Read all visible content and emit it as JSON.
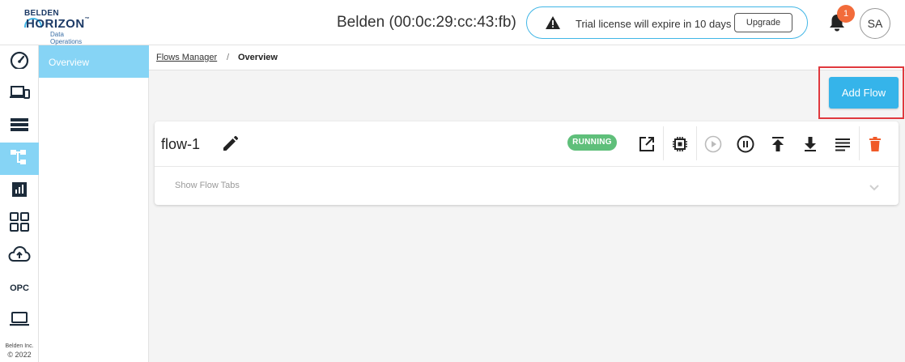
{
  "header": {
    "logo": {
      "line1": "BELDEN",
      "line2": "HORIZON",
      "tm": "™",
      "line3": "Data Operations"
    },
    "device_title": "Belden (00:0c:29:cc:43:fb)",
    "license": {
      "text": "Trial license will expire in 10 days",
      "upgrade_label": "Upgrade"
    },
    "notifications": {
      "count": "1"
    },
    "avatar_initials": "SA"
  },
  "rail": {
    "items": [
      {
        "name": "dashboard-gauge-icon"
      },
      {
        "name": "devices-icon"
      },
      {
        "name": "list-storage-icon"
      },
      {
        "name": "flows-hierarchy-icon",
        "active": true
      },
      {
        "name": "analytics-icon"
      },
      {
        "name": "apps-grid-icon"
      },
      {
        "name": "cloud-upload-icon"
      },
      {
        "name": "opc",
        "label": "OPC"
      },
      {
        "name": "laptop-icon"
      }
    ],
    "footer": {
      "company": "Belden Inc.",
      "year": "© 2022"
    }
  },
  "subnav": {
    "items": [
      {
        "label": "Overview",
        "active": true
      }
    ]
  },
  "breadcrumb": {
    "parent": "Flows Manager",
    "separator": "/",
    "current": "Overview"
  },
  "toolbar": {
    "add_flow_label": "Add Flow"
  },
  "flow": {
    "name": "flow-1",
    "status": "RUNNING",
    "show_tabs_label": "Show Flow Tabs",
    "actions": [
      "open-external-icon",
      "chip-icon",
      "play-icon",
      "pause-icon",
      "upload-icon",
      "download-icon",
      "logs-icon",
      "delete-icon"
    ]
  },
  "colors": {
    "accent": "#35b4ea",
    "active_nav": "#86d4f5",
    "running": "#5fbf7a",
    "danger": "#e0393e",
    "badge": "#f26b3a"
  }
}
